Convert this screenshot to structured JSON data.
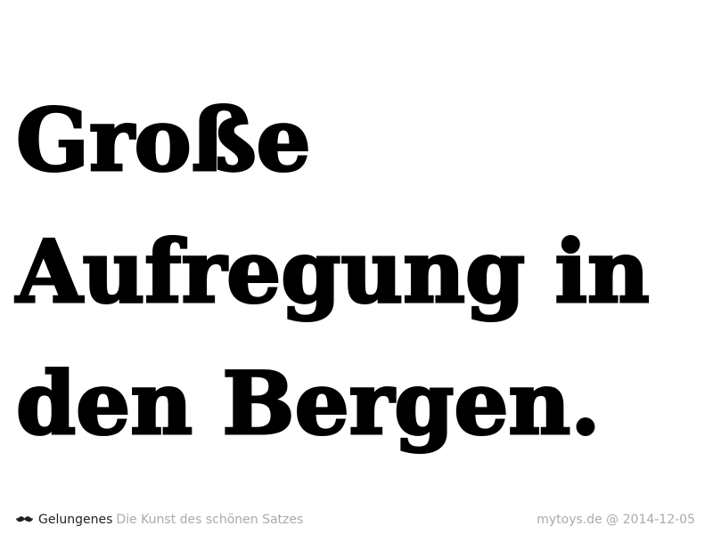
{
  "headline": {
    "lines": [
      "Große",
      "Aufregung in",
      "den Bergen."
    ]
  },
  "footer": {
    "brand_icon": "mustache-icon",
    "brand_name": "Gelungenes",
    "tagline": "Die Kunst des schönen Satzes",
    "source": "mytoys.de @ 2014-12-05"
  },
  "colors": {
    "background": "#ffffff",
    "headline": "#000000",
    "brand": "#222222",
    "muted": "#aaaaaa"
  }
}
